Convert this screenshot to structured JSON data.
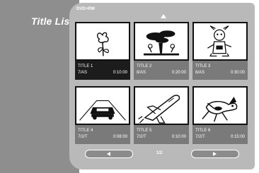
{
  "screen": {
    "title": "Title List",
    "disc_type": "DVD+RW"
  },
  "titles": [
    {
      "label": "TITLE 1",
      "date": "7/AS",
      "time": "0:10:00",
      "selected": true,
      "icon": "rose-icon"
    },
    {
      "label": "TITLE 2",
      "date": "8/AS",
      "time": "0:20:00",
      "selected": false,
      "icon": "bonsai-tree-icon"
    },
    {
      "label": "TITLE 3",
      "date": "6/AS",
      "time": "0:30:00",
      "selected": false,
      "icon": "cartoon-character-icon"
    },
    {
      "label": "TITLE 4",
      "date": "7/2/T",
      "time": "0:08:00",
      "selected": false,
      "icon": "car-road-icon"
    },
    {
      "label": "TITLE 5",
      "date": "7/2/T",
      "time": "0:10:00",
      "selected": false,
      "icon": "space-shuttle-icon"
    },
    {
      "label": "TITLE 6",
      "date": "7/2/T",
      "time": "0:15:00",
      "selected": false,
      "icon": "dog-icon"
    }
  ],
  "pager": {
    "page": "1/2",
    "prev_icon": "triangle-left-icon",
    "next_icon": "triangle-right-icon"
  },
  "colors": {
    "left_bg": "#8e8e8e",
    "panel_bg": "#b9b9b9",
    "info_bg": "#7a7a7a",
    "selected_info_bg": "#1c1c1c"
  }
}
